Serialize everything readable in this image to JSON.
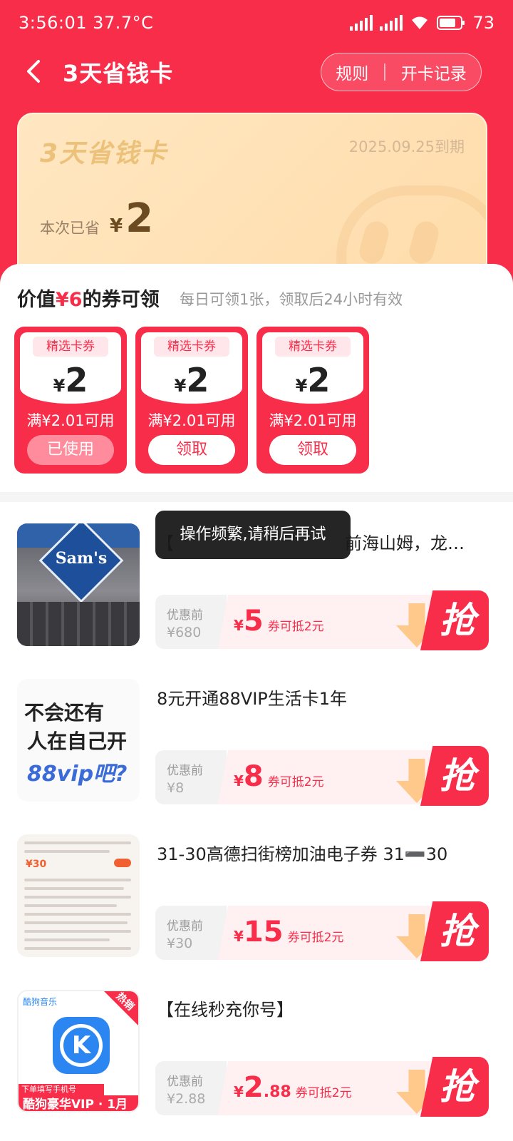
{
  "status": {
    "time": "3:56:01",
    "temp": "37.7°C",
    "battery": "73"
  },
  "nav": {
    "title": "3天省钱卡",
    "rules": "规则",
    "records": "开卡记录"
  },
  "card": {
    "title": "3天省钱卡",
    "expiry": "2025.09.25到期",
    "saved_label": "本次已省",
    "currency": "¥",
    "saved_value": "2"
  },
  "coupons": {
    "title_prefix": "价值",
    "title_value": "¥6",
    "title_suffix": "的券可领",
    "subtitle": "每日可领1张，领取后24小时有效",
    "items": [
      {
        "tag": "精选卡券",
        "currency": "¥",
        "amount": "2",
        "condition": "满¥2.01可用",
        "button": "已使用",
        "used": true
      },
      {
        "tag": "精选卡券",
        "currency": "¥",
        "amount": "2",
        "condition": "满¥2.01可用",
        "button": "领取",
        "used": false
      },
      {
        "tag": "精选卡券",
        "currency": "¥",
        "amount": "2",
        "condition": "满¥2.01可用",
        "button": "领取",
        "used": false
      }
    ]
  },
  "toast": "操作频繁,请稍后再试",
  "products": [
    {
      "title": "【",
      "title_tail": "前海山姆，龙…",
      "before_label": "优惠前",
      "before_price": "¥680",
      "currency": "¥",
      "price": "5",
      "price_dec": "",
      "note": "券可抵2元",
      "grab": "抢",
      "thumb_text": "Sam's"
    },
    {
      "title": "8元开通88VIP生活卡1年",
      "before_label": "优惠前",
      "before_price": "¥8",
      "currency": "¥",
      "price": "8",
      "price_dec": "",
      "note": "券可抵2元",
      "grab": "抢",
      "thumb_lines": [
        "不会还有",
        "人在自己开",
        "88vip吧?"
      ]
    },
    {
      "title": "31-30高德扫街榜加油电子券 31➖30",
      "before_label": "优惠前",
      "before_price": "¥30",
      "currency": "¥",
      "price": "15",
      "price_dec": "",
      "note": "券可抵2元",
      "grab": "抢",
      "thumb_amount": "¥30"
    },
    {
      "title": "【在线秒充你号】",
      "before_label": "优惠前",
      "before_price": "¥2.88",
      "currency": "¥",
      "price": "2",
      "price_dec": ".88",
      "note": "券可抵2元",
      "grab": "抢",
      "thumb_hot": "热销",
      "thumb_brand": "酷狗音乐",
      "thumb_bar1": "下单填写手机号",
      "thumb_bar2": "酷狗豪华VIP · 1月"
    }
  ],
  "colors": {
    "brand": "#f82d49",
    "card": "#ffe2b5"
  }
}
